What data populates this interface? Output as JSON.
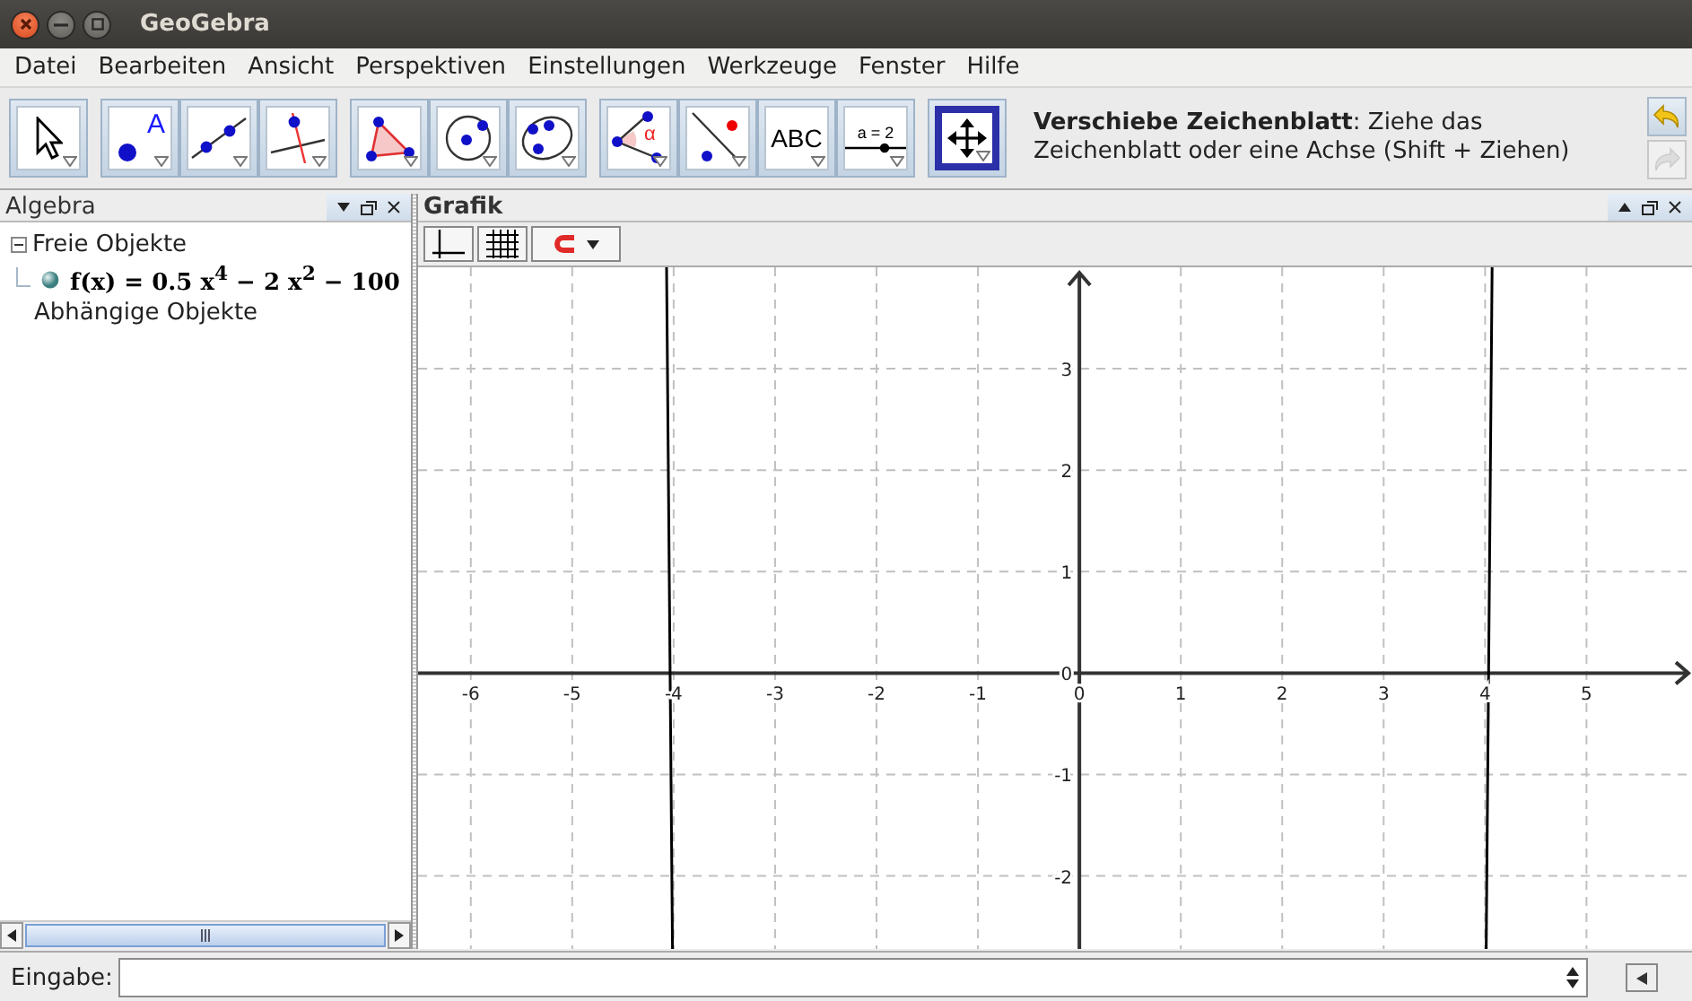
{
  "window": {
    "title": "GeoGebra"
  },
  "menu": [
    "Datei",
    "Bearbeiten",
    "Ansicht",
    "Perspektiven",
    "Einstellungen",
    "Werkzeuge",
    "Fenster",
    "Hilfe"
  ],
  "toolbar": {
    "groups": [
      [
        {
          "kind": "move",
          "selected": false
        }
      ],
      [
        {
          "kind": "point",
          "label": "A",
          "selected": false
        },
        {
          "kind": "line",
          "selected": false
        },
        {
          "kind": "perpendicular",
          "selected": false
        }
      ],
      [
        {
          "kind": "polygon",
          "selected": false
        },
        {
          "kind": "circle",
          "selected": false
        },
        {
          "kind": "conic",
          "selected": false
        }
      ],
      [
        {
          "kind": "angle",
          "label": "α",
          "selected": false
        },
        {
          "kind": "reflect",
          "selected": false
        },
        {
          "kind": "text",
          "label": "ABC",
          "selected": false
        },
        {
          "kind": "slider",
          "label": "a = 2",
          "selected": false
        }
      ],
      [
        {
          "kind": "move_view",
          "selected": true
        }
      ]
    ],
    "help": "**Verschiebe Zeichenblatt**: Ziehe das Zeichenblatt oder eine Achse (Shift + Ziehen)",
    "undo": {
      "disabled": false
    },
    "redo": {
      "disabled": true
    }
  },
  "algebra": {
    "title": "Algebra",
    "tree": [
      {
        "label": "Freie Objekte",
        "expanded": true,
        "children": [
          {
            "label": "f(x) = 0.5 x$^{4}$ − 2 x$^{2}$ − 100"
          }
        ]
      },
      {
        "label": "Abhängige Objekte"
      }
    ]
  },
  "graphics": {
    "title": "Grafik",
    "chart_data": {
      "type": "line",
      "grid": true,
      "x": [
        -4.0696,
        -4.0114,
        4.0114,
        4.0696
      ],
      "series": [
        {
          "color": "#000000",
          "values": [
            4.0,
            -2.72,
            null,
            null
          ]
        },
        {
          "color": "#000000",
          "values": [
            null,
            null,
            -2.72,
            4.0
          ]
        }
      ],
      "xlim": [
        -6.52,
        6.04
      ],
      "ylim": [
        -2.72,
        4.0
      ],
      "xticks": [
        -6,
        -5,
        -4,
        -3,
        -2,
        -1,
        0,
        1,
        2,
        3,
        4,
        5
      ],
      "yticks": [
        -2,
        -1,
        0,
        1,
        2,
        3
      ]
    }
  },
  "input": {
    "label": "Eingabe:"
  }
}
